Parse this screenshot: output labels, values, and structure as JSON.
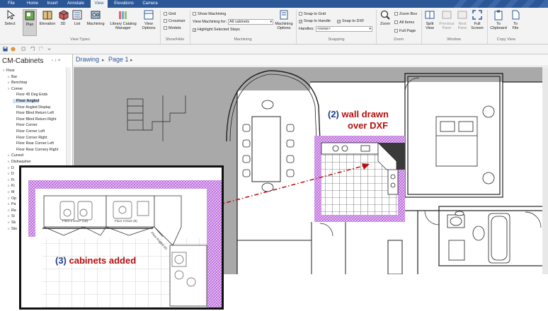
{
  "tabs": [
    {
      "label": "File"
    },
    {
      "label": "Home"
    },
    {
      "label": "Insert"
    },
    {
      "label": "Annotate"
    },
    {
      "label": "View"
    },
    {
      "label": "Elevations"
    },
    {
      "label": "Camera"
    }
  ],
  "ribbon": {
    "select": "Select",
    "plan": "Plan",
    "elevation": "Elevation",
    "three_d": "3D",
    "list": "List",
    "machining": "Machining",
    "library_manager": "Library Catalog Manager",
    "view_options": "View Options",
    "view_types_group": "View Types",
    "grid": "Grid",
    "crosshair": "Crosshair",
    "models": "Models",
    "showhide_group": "Show/Hide",
    "show_machining": "Show Machining",
    "view_machining_for": "View Machining for:",
    "machining_combo_value": "All cabinets",
    "highlight_selected": "Highlight Selected Steps",
    "machining_options": "Machining Options",
    "machining_group": "Machining",
    "snap_grid": "Snap to Grid",
    "snap_handle": "Snap to Handle",
    "snap_dxf": "Snap to DXF",
    "handles_label": "Handles:",
    "handles_value": "<none>",
    "snapping_group": "Snapping",
    "zoom": "Zoom",
    "zoom_box": "Zoom Box",
    "all_items": "All Items",
    "full_page": "Full Page",
    "zoom_group": "Zoom",
    "split_view": "Split View",
    "previous_pane": "Previous Pane",
    "next_pane": "Next Pane",
    "full_screen": "Full Screen",
    "window_group": "Window",
    "to_clipboard": "To Clipboard",
    "to_file": "To File",
    "copy_view_group": "Copy View"
  },
  "breadcrumb": {
    "drawing": "Drawing",
    "page": "Page 1"
  },
  "panel": {
    "title": "CM-Cabinets",
    "pin": "− ↕ ×",
    "tree": [
      {
        "label": "Floor",
        "level": 0,
        "arrow": "▿"
      },
      {
        "label": "Bar",
        "level": 1,
        "arrow": "▹"
      },
      {
        "label": "Benchtop",
        "level": 1,
        "arrow": "▹"
      },
      {
        "label": "Corner",
        "level": 1,
        "arrow": "▿"
      },
      {
        "label": "Floor 45 Deg Ends",
        "level": 2,
        "arrow": ""
      },
      {
        "label": "Floor Angled",
        "level": 2,
        "arrow": "",
        "selected": true
      },
      {
        "label": "Floor Angled Display",
        "level": 2,
        "arrow": ""
      },
      {
        "label": "Floor Blind Return Left",
        "level": 2,
        "arrow": ""
      },
      {
        "label": "Floor Blind Return Right",
        "level": 2,
        "arrow": ""
      },
      {
        "label": "Floor Corner",
        "level": 2,
        "arrow": ""
      },
      {
        "label": "Floor Corner Left",
        "level": 2,
        "arrow": ""
      },
      {
        "label": "Floor Corner Right",
        "level": 2,
        "arrow": ""
      },
      {
        "label": "Floor Rear Corner Left",
        "level": 2,
        "arrow": ""
      },
      {
        "label": "Floor Rear Cornery Right",
        "level": 2,
        "arrow": ""
      },
      {
        "label": "Curved",
        "level": 1,
        "arrow": "▹"
      },
      {
        "label": "Dishwasher",
        "level": 1,
        "arrow": "▹"
      },
      {
        "label": "D",
        "level": 1,
        "arrow": "▹"
      },
      {
        "label": "D",
        "level": 1,
        "arrow": "▹"
      },
      {
        "label": "Fi",
        "level": 1,
        "arrow": "▹"
      },
      {
        "label": "Ki",
        "level": 1,
        "arrow": "▹"
      },
      {
        "label": "M",
        "level": 1,
        "arrow": "▹"
      },
      {
        "label": "Op",
        "level": 1,
        "arrow": "▹"
      },
      {
        "label": "Pa",
        "level": 1,
        "arrow": "▹"
      },
      {
        "label": "Re",
        "level": 1,
        "arrow": "▹"
      },
      {
        "label": "Si",
        "level": 1,
        "arrow": "▹"
      },
      {
        "label": "Sk",
        "level": 1,
        "arrow": "▹"
      },
      {
        "label": "Sto",
        "level": 1,
        "arrow": "▹"
      }
    ]
  },
  "annotations": {
    "note2_num": "(2)",
    "note2_line1": "wall drawn",
    "note2_line2": "over DXF",
    "note3_num": "(3)",
    "note3_text": "cabinets added"
  },
  "inset_labels": {
    "floor2door1": "Floor 2 Door* (18)",
    "floor2door2": "Floor 2 Door (6)",
    "floor_angled": "Floor Angled (6)"
  },
  "colors": {
    "accent": "#2b5797",
    "annotation_red": "#b80d0d",
    "annotation_blue": "#1c3f8f",
    "wall_hatch": "#c58be6",
    "canvas_bg": "#a9a9a9"
  }
}
